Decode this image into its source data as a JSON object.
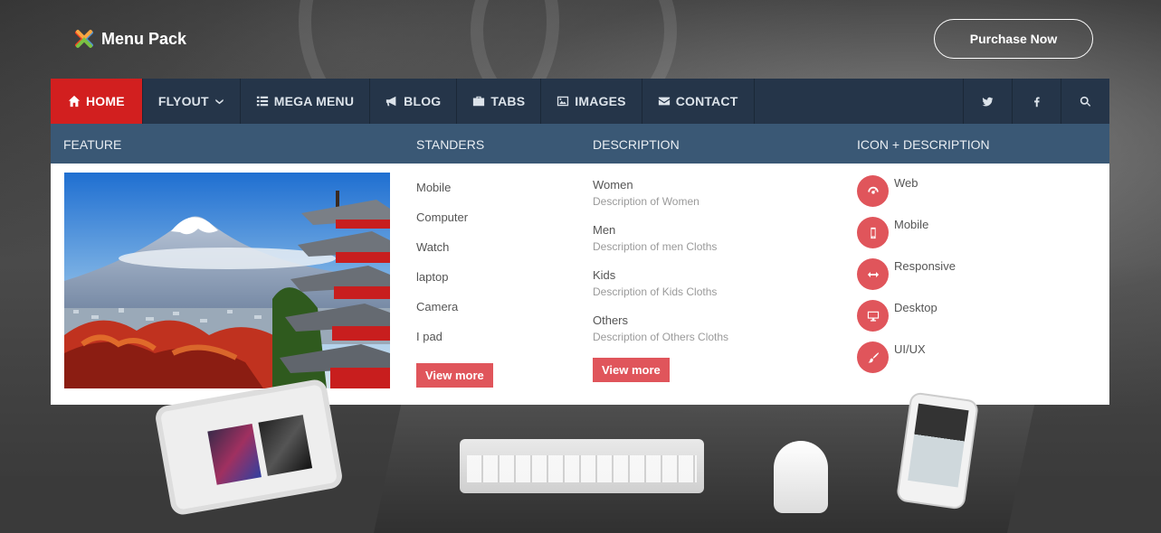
{
  "brand": {
    "name": "Menu Pack"
  },
  "header": {
    "purchase_label": "Purchase Now"
  },
  "nav": {
    "items": [
      {
        "label": "HOME",
        "icon": "home-icon",
        "active": true
      },
      {
        "label": "FLYOUT",
        "icon": "chevron-down-icon",
        "active": false
      },
      {
        "label": "MEGA MENU",
        "icon": "list-icon",
        "active": false
      },
      {
        "label": "BLOG",
        "icon": "bullhorn-icon",
        "active": false
      },
      {
        "label": "TABS",
        "icon": "briefcase-icon",
        "active": false
      },
      {
        "label": "IMAGES",
        "icon": "image-icon",
        "active": false
      },
      {
        "label": "CONTACT",
        "icon": "envelope-icon",
        "active": false
      }
    ],
    "right_icons": [
      "twitter-icon",
      "facebook-icon",
      "search-icon"
    ]
  },
  "mega": {
    "headings": {
      "feature": "FEATURE",
      "standers": "STANDERS",
      "description": "DESCRIPTION",
      "icon_description": "ICON + DESCRIPTION"
    },
    "standers": [
      "Mobile",
      "Computer",
      "Watch",
      "laptop",
      "Camera",
      "I pad"
    ],
    "standers_view_more": "View more",
    "descriptions": [
      {
        "title": "Women",
        "sub": "Description of Women"
      },
      {
        "title": "Men",
        "sub": "Description of men Cloths"
      },
      {
        "title": "Kids",
        "sub": "Description of Kids Cloths"
      },
      {
        "title": "Others",
        "sub": "Description of Others Cloths"
      }
    ],
    "descriptions_view_more": "View more",
    "icon_items": [
      {
        "label": "Web",
        "icon": "dashboard-icon"
      },
      {
        "label": "Mobile",
        "icon": "mobile-icon"
      },
      {
        "label": "Responsive",
        "icon": "arrows-h-icon"
      },
      {
        "label": "Desktop",
        "icon": "desktop-icon"
      },
      {
        "label": "UI/UX",
        "icon": "paint-brush-icon"
      }
    ]
  },
  "colors": {
    "nav_bg": "#253549",
    "active_bg": "#d21f1f",
    "mega_head_bg": "#3a5875",
    "accent": "#e0555b"
  }
}
